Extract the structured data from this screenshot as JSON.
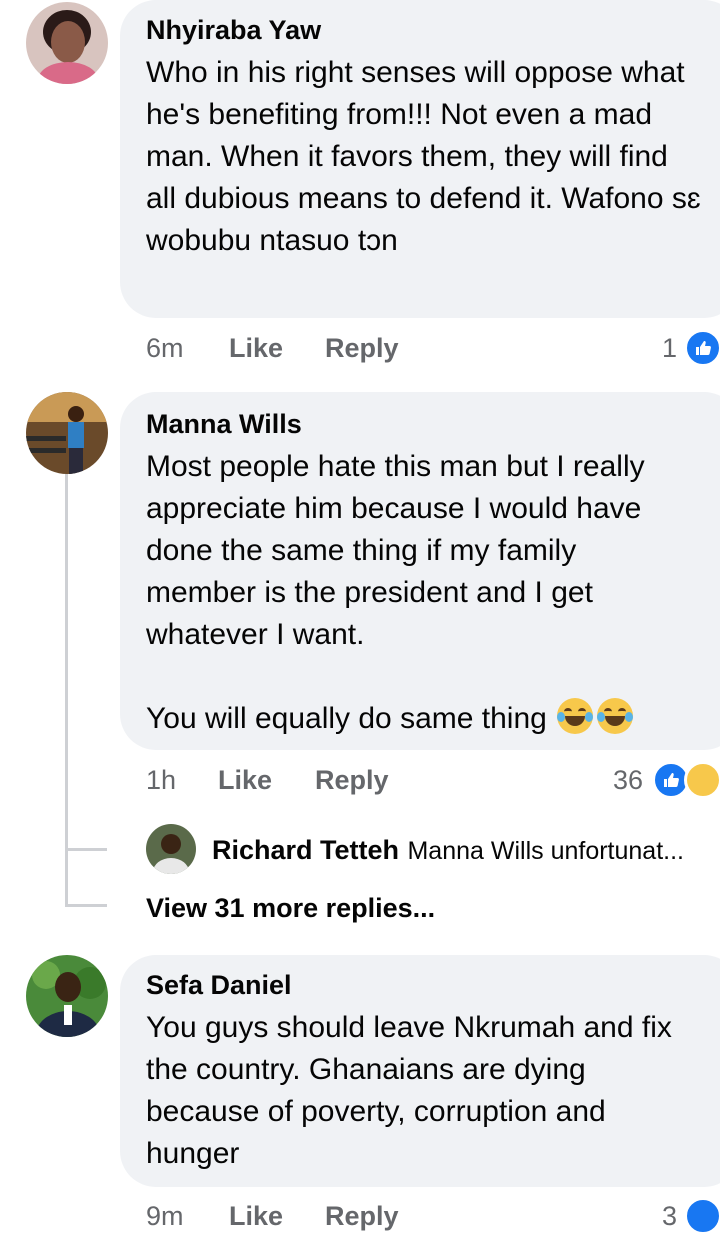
{
  "comments": [
    {
      "author": "Nhyiraba Yaw",
      "text": "Who in his right senses will oppose what he's benefiting from!!! Not even a mad man. When it favors them, they will find all dubious means to defend it. Wafono sɛ wobubu ntasuo tɔn",
      "time": "6m",
      "like_label": "Like",
      "reply_label": "Reply",
      "reaction_count": "1"
    },
    {
      "author": "Manna Wills",
      "text_line1": "Most people hate this man but I really appreciate him because I would have done the same thing if my family member is the president and I get whatever I want.",
      "text_line2": "You will equally do same thing",
      "time": "1h",
      "like_label": "Like",
      "reply_label": "Reply",
      "reaction_count": "36",
      "reply_preview": {
        "author": "Richard Tetteh",
        "text": "Manna Wills unfortunat..."
      },
      "view_more": "View 31 more replies..."
    },
    {
      "author": "Sefa Daniel",
      "text": "You guys should leave Nkrumah and fix the country. Ghanaians are dying because of poverty, corruption and hunger",
      "time": "9m",
      "like_label": "Like",
      "reply_label": "Reply",
      "reaction_count": "3"
    }
  ],
  "colors": {
    "bubble": "#f0f2f5",
    "like_blue": "#1877f2",
    "meta_gray": "#65676b"
  }
}
